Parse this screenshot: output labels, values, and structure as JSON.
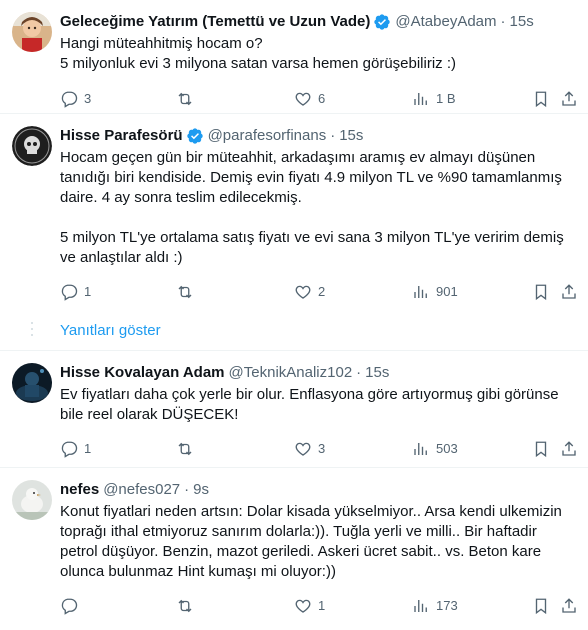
{
  "colors": {
    "accent": "#1d9bf0",
    "text": "#0f1419",
    "muted": "#536471",
    "divider": "#eff3f4"
  },
  "tweets": [
    {
      "name": "Geleceğime Yatırım (Temettü ve Uzun Vade)",
      "verified": true,
      "handle": "@AtabeyAdam",
      "dot": "·",
      "time": "15s",
      "text": "Hangi müteahhitmiş hocam o?\n5 milyonluk evi 3 milyona satan varsa hemen görüşebiliriz :)",
      "replies": "3",
      "retweets": "",
      "likes": "6",
      "views": "1 B"
    },
    {
      "name": "Hisse Parafesörü",
      "verified": true,
      "handle": "@parafesorfinans",
      "dot": "·",
      "time": "15s",
      "text": "Hocam geçen gün bir müteahhit, arkadaşımı aramış ev almayı düşünen tanıdığı biri kendiside. Demiş evin fiyatı 4.9 milyon TL ve %90 tamamlanmış daire. 4 ay sonra teslim edilecekmiş.\n\n5 milyon TL'ye ortalama satış fiyatı ve evi sana 3 milyon TL'ye veririm demiş ve anlaştılar aldı :)",
      "replies": "1",
      "retweets": "",
      "likes": "2",
      "views": "901"
    },
    {
      "name": "Hisse Kovalayan Adam",
      "verified": false,
      "handle": "@TeknikAnaliz102",
      "dot": "·",
      "time": "15s",
      "text": "Ev fiyatları daha çok yerle bir olur. Enflasyona göre artıyormuş gibi görünse bile reel olarak DÜŞECEK!",
      "replies": "1",
      "retweets": "",
      "likes": "3",
      "views": "503"
    },
    {
      "name": "nefes",
      "verified": false,
      "handle": "@nefes027",
      "dot": "·",
      "time": "9s",
      "text": "Konut fiyatlari neden artsın: Dolar kisada yükselmiyor.. Arsa kendi ulkemizin toprağı ithal etmiyoruz sanırım dolarla:)). Tuğla yerli ve milli.. Bir haftadir petrol düşüyor. Benzin, mazot geriledi. Askeri ücret sabit.. vs. Beton kare olunca bulunmaz Hint kumaşı mi oluyor:))",
      "replies": "",
      "retweets": "",
      "likes": "1",
      "views": "173"
    }
  ],
  "show_replies_label": "Yanıtları göster"
}
